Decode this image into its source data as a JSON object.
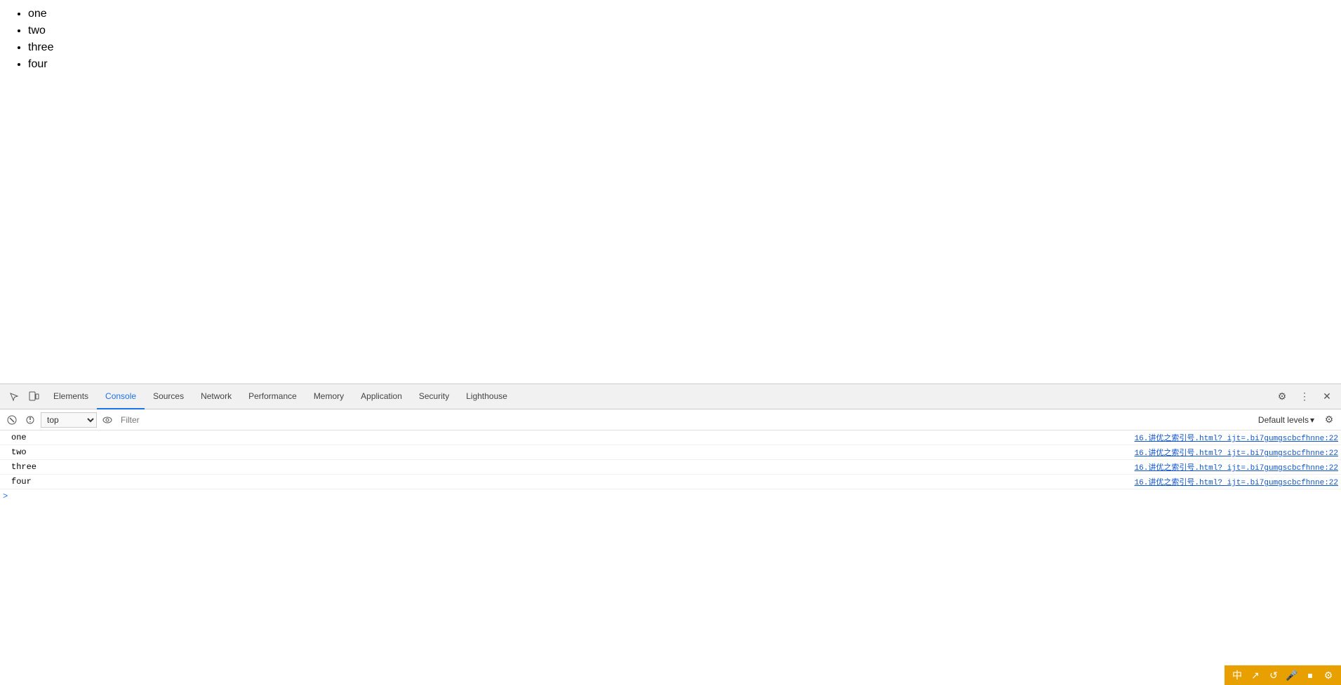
{
  "page": {
    "list_items": [
      "one",
      "two",
      "three",
      "four"
    ]
  },
  "devtools": {
    "tabs": [
      {
        "id": "elements",
        "label": "Elements",
        "active": false
      },
      {
        "id": "console",
        "label": "Console",
        "active": true
      },
      {
        "id": "sources",
        "label": "Sources",
        "active": false
      },
      {
        "id": "network",
        "label": "Network",
        "active": false
      },
      {
        "id": "performance",
        "label": "Performance",
        "active": false
      },
      {
        "id": "memory",
        "label": "Memory",
        "active": false
      },
      {
        "id": "application",
        "label": "Application",
        "active": false
      },
      {
        "id": "security",
        "label": "Security",
        "active": false
      },
      {
        "id": "lighthouse",
        "label": "Lighthouse",
        "active": false
      }
    ],
    "filter_bar": {
      "context": "top",
      "filter_placeholder": "Filter",
      "default_levels_label": "Default levels"
    },
    "console_rows": [
      {
        "text": "one",
        "source": "16.讲优之索引号.html? ijt=.bi7gumgscbcfhnne:22"
      },
      {
        "text": "two",
        "source": "16.讲优之索引号.html? ijt=.bi7gumgscbcfhnne:22"
      },
      {
        "text": "three",
        "source": "16.讲优之索引号.html? ijt=.bi7gumgscbcfhnne:22"
      },
      {
        "text": "four",
        "source": "16.讲优之索引号.html? ijt=.bi7gumgscbcfhnne:22"
      }
    ]
  },
  "statusbar": {
    "icons": [
      "中",
      "↗",
      "↺",
      "🎤",
      "⏹",
      "⚙"
    ]
  }
}
